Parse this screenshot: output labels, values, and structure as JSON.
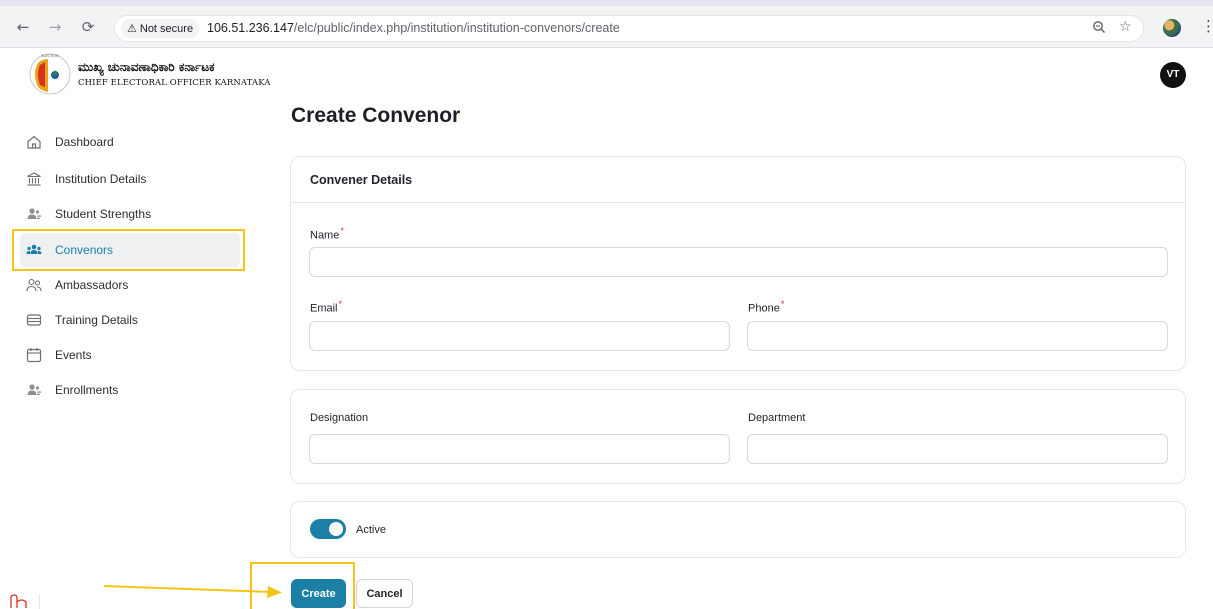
{
  "browser": {
    "security_label": "Not secure",
    "url_host": "106.51.236.147",
    "url_path": "/elc/public/index.php/institution/institution-convenors/create"
  },
  "header": {
    "org_name_kannada": "ಮುಖ್ಯ ಚುನಾವಣಾಧಿಕಾರಿ ಕರ್ನಾಟಕ",
    "org_name_english": "CHIEF ELECTORAL OFFICER KARNATAKA",
    "avatar_initials": "VT"
  },
  "sidebar": {
    "items": [
      {
        "label": "Dashboard",
        "icon": "home-icon"
      },
      {
        "label": "Institution Details",
        "icon": "institution-icon"
      },
      {
        "label": "Student Strengths",
        "icon": "users-icon"
      },
      {
        "label": "Convenors",
        "icon": "group-icon",
        "active": true
      },
      {
        "label": "Ambassadors",
        "icon": "people-outline-icon"
      },
      {
        "label": "Training Details",
        "icon": "training-icon"
      },
      {
        "label": "Events",
        "icon": "calendar-icon"
      },
      {
        "label": "Enrollments",
        "icon": "users-icon"
      }
    ]
  },
  "main": {
    "page_title": "Create Convenor",
    "section_title": "Convener Details",
    "fields": {
      "name_label": "Name",
      "email_label": "Email",
      "phone_label": "Phone",
      "designation_label": "Designation",
      "department_label": "Department",
      "required_marker": "*"
    },
    "active_toggle": {
      "label": "Active",
      "checked": true
    },
    "buttons": {
      "create": "Create",
      "cancel": "Cancel"
    }
  },
  "colors": {
    "accent": "#1b7fa6",
    "highlight": "#f7c316",
    "required": "#d93025"
  }
}
